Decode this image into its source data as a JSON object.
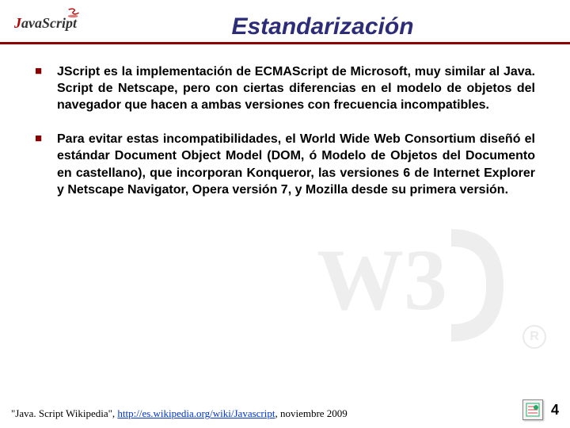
{
  "header": {
    "logo_text_prefix": "J",
    "logo_text_rest": "avaScript",
    "title": "Estandarización"
  },
  "bullets": [
    "JScript es la implementación de ECMAScript de Microsoft, muy similar al Java. Script de Netscape, pero con ciertas diferencias en el modelo de objetos del navegador que hacen a ambas versiones con frecuencia incompatibles.",
    "Para evitar estas incompatibilidades, el World Wide Web Consortium diseñó el estándar Document Object Model (DOM, ó Modelo de Objetos del Documento en castellano), que incorporan Konqueror, las versiones 6 de Internet Explorer y Netscape Navigator, Opera versión 7, y Mozilla desde su primera versión."
  ],
  "footer": {
    "cite_prefix": "\"Java. Script Wikipedia\", ",
    "cite_link_text": "http://es.wikipedia.org/wiki/Javascript",
    "cite_link_href": "http://es.wikipedia.org/wiki/Javascript",
    "cite_suffix": ", noviembre 2009",
    "page_number": "4"
  },
  "watermark": {
    "label": "W3C",
    "registered": "R"
  }
}
